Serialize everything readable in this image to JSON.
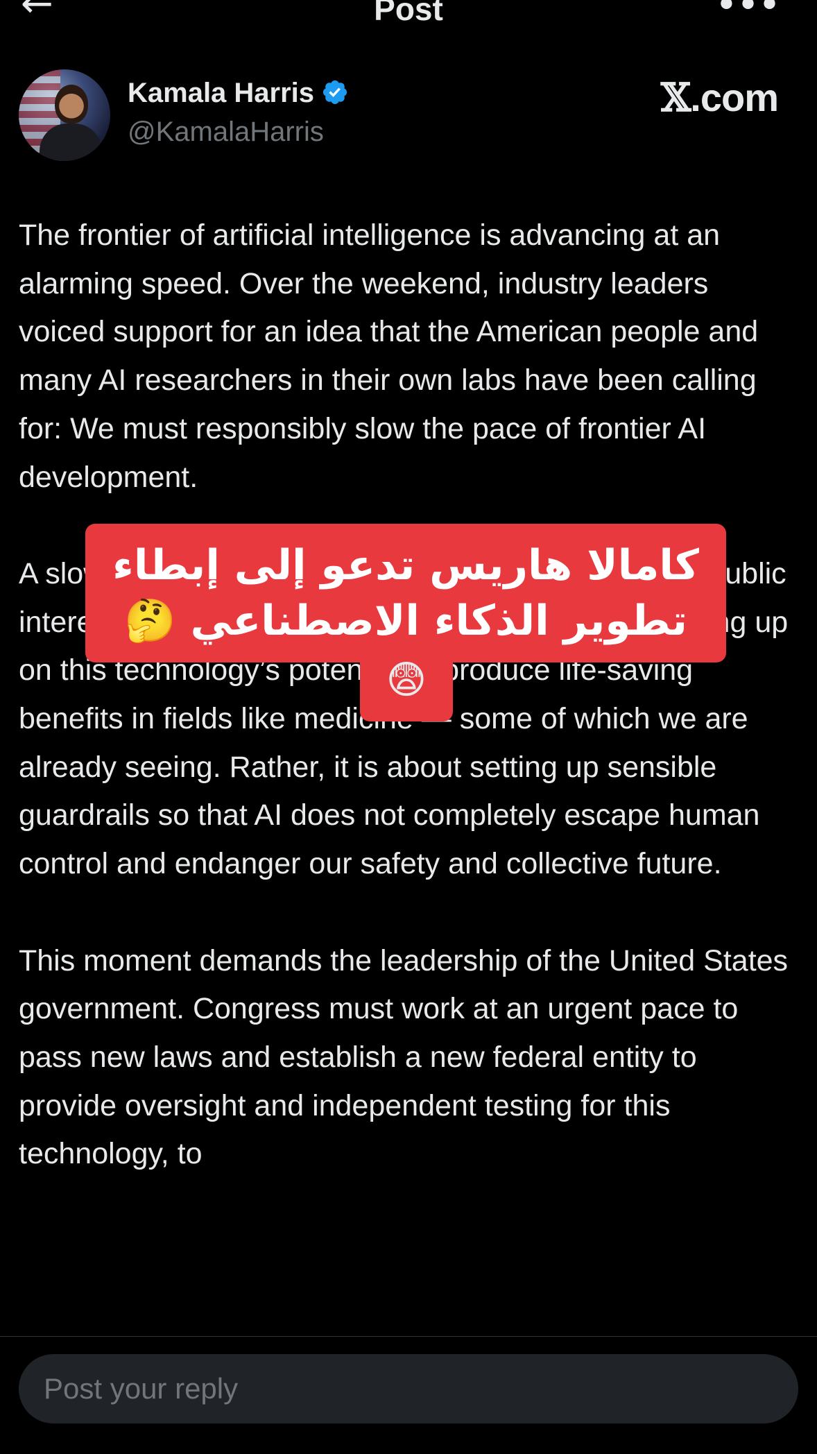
{
  "header": {
    "back_icon": "arrow-left-icon",
    "title": "Post",
    "more_icon": "more-horizontal-icon"
  },
  "author": {
    "name": "Kamala Harris",
    "handle": "@KamalaHarris",
    "verified": true,
    "badge_color": "#1d9bf0"
  },
  "watermark": {
    "x_glyph": "𝕏",
    "suffix": ".com"
  },
  "post": {
    "paragraphs": [
      "The frontier of artificial intelligence is advancing at an alarming speed. Over the weekend, industry leaders voiced support for an idea that the American people and many AI researchers in their own labs have been calling for: We must responsibly slow the pace of frontier AI development.",
      "A slower, more deliberate approach to AI serves the public interest. Pausing AI development does not mean giving up on this technology’s potential to produce life-saving benefits in fields like medicine — some of which we are already seeing. Rather, it is about setting up sensible guardrails so that AI does not completely escape human control and endanger our safety and collective future.",
      "This moment demands the leadership of the United States government. Congress must work at an urgent pace to pass new laws and establish a new federal entity to provide oversight and independent testing for this technology, to"
    ]
  },
  "overlay": {
    "line1": "كامالا هاريس تدعو إلى إبطاء",
    "line2": "تطوير الذكاء الاصطناعي 🤔",
    "emoji": "😨",
    "bg_color": "#e8393f"
  },
  "reply": {
    "placeholder": "Post your reply"
  },
  "colors": {
    "background": "#000000",
    "text": "#e7e9ea",
    "muted": "#71767b",
    "accent": "#1d9bf0"
  }
}
